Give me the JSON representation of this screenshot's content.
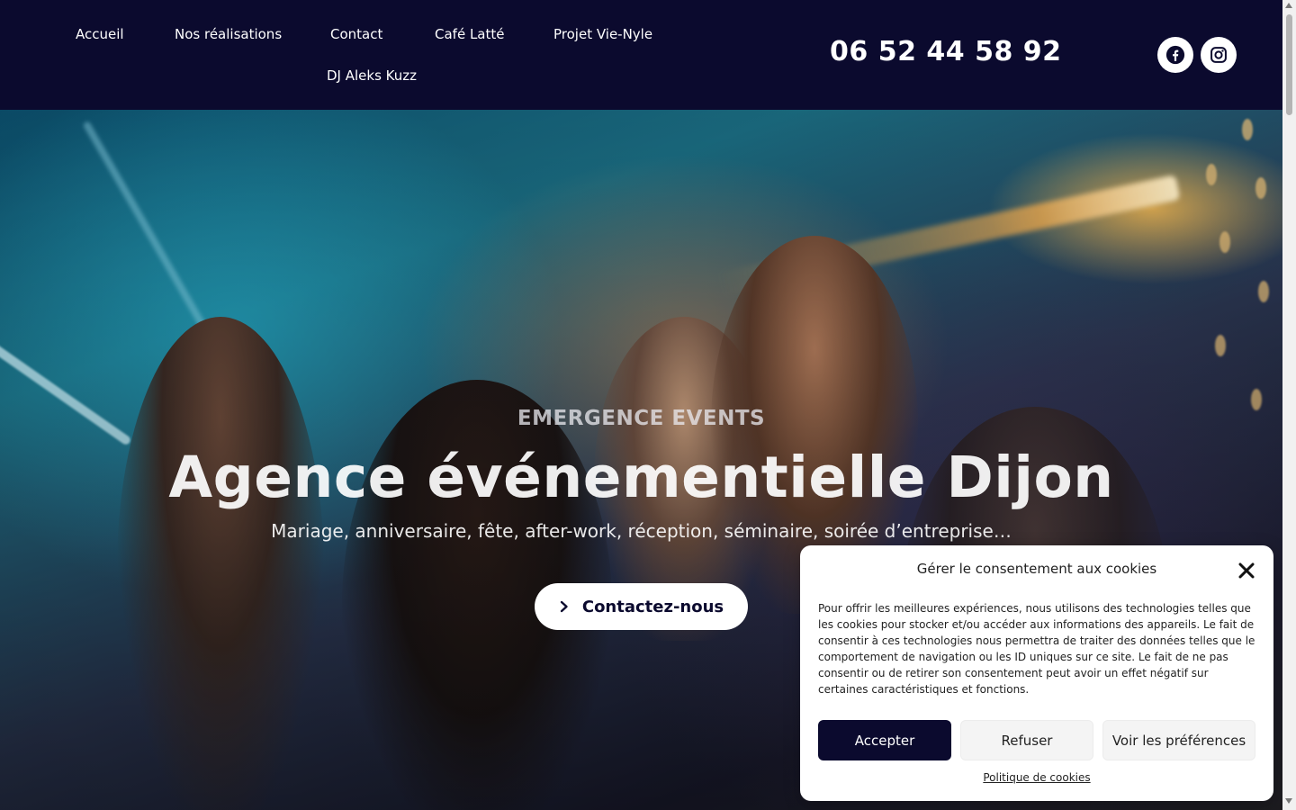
{
  "nav": {
    "items": [
      {
        "label": "Accueil"
      },
      {
        "label": "Nos réalisations"
      },
      {
        "label": "Contact"
      },
      {
        "label": "Café Latté"
      },
      {
        "label": "Projet Vie-Nyle"
      },
      {
        "label": "DJ Aleks Kuzz"
      }
    ]
  },
  "header": {
    "phone": "06 52 44 58 92",
    "social": [
      {
        "icon": "facebook-icon"
      },
      {
        "icon": "instagram-icon"
      }
    ]
  },
  "hero": {
    "eyebrow": "EMERGENCE EVENTS",
    "title": "Agence événementielle Dijon",
    "subtitle": "Mariage, anniversaire, fête, after-work, réception, séminaire, soirée d’entreprise…",
    "cta_label": "Contactez-nous",
    "cta_icon": "chevron-right-icon"
  },
  "cookie": {
    "title": "Gérer le consentement aux cookies",
    "text": "Pour offrir les meilleures expériences, nous utilisons des technologies telles que les cookies pour stocker et/ou accéder aux informations des appareils. Le fait de consentir à ces technologies nous permettra de traiter des données telles que le comportement de navigation ou les ID uniques sur ce site. Le fait de ne pas consentir ou de retirer son consentement peut avoir un effet négatif sur certaines caractéristiques et fonctions.",
    "accept_label": "Accepter",
    "refuse_label": "Refuser",
    "prefs_label": "Voir les préférences",
    "policy_link": "Politique de cookies"
  },
  "colors": {
    "header_bg": "#0b0a2e",
    "accent": "#0b0a2e",
    "white": "#ffffff"
  }
}
